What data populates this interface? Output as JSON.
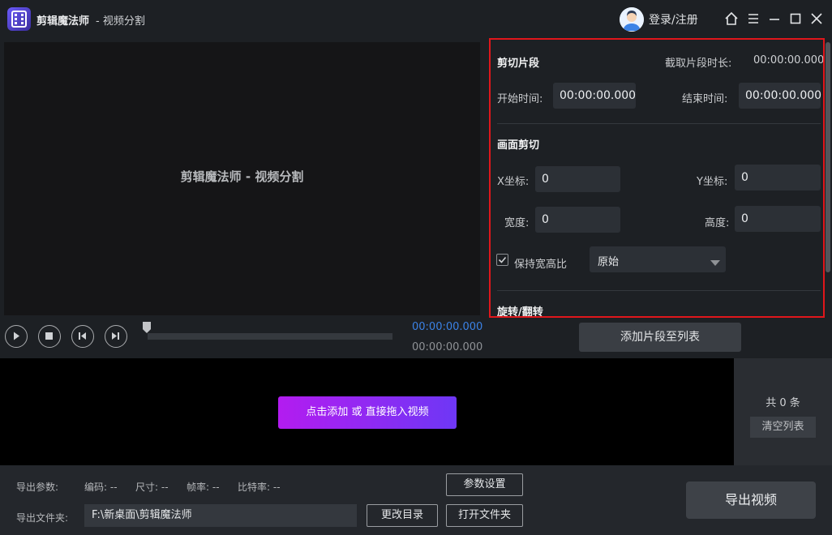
{
  "titlebar": {
    "app_name": "剪辑魔法师",
    "app_sub": "- 视频分割",
    "login": "登录/注册"
  },
  "preview": {
    "title": "剪辑魔法师 - 视频分割"
  },
  "player": {
    "current_time": "00:00:00.000",
    "total_time": "00:00:00.000",
    "progress": 0
  },
  "cut_segment": {
    "title": "剪切片段",
    "duration_label": "截取片段时长:",
    "duration_value": "00:00:00.000",
    "start_label": "开始时间:",
    "start_value": "00:00:00.000",
    "end_label": "结束时间:",
    "end_value": "00:00:00.000"
  },
  "crop": {
    "title": "画面剪切",
    "x_label": "X坐标:",
    "x_value": "0",
    "y_label": "Y坐标:",
    "y_value": "0",
    "width_label": "宽度:",
    "width_value": "0",
    "height_label": "高度:",
    "height_value": "0",
    "keep_ratio_label": "保持宽高比",
    "keep_ratio_checked": true,
    "ratio_selected": "原始"
  },
  "rotate": {
    "title": "旋转/翻转"
  },
  "add_segment_button": "添加片段至列表",
  "list": {
    "add_video_button": "点击添加 或 直接拖入视频",
    "count_text": "共 0 条",
    "clear_button": "清空列表"
  },
  "export": {
    "params_label": "导出参数:",
    "codec": "编码: --",
    "size": "尺寸: --",
    "fps": "帧率: --",
    "bitrate": "比特率: --",
    "settings_button": "参数设置",
    "folder_label": "导出文件夹:",
    "folder_path": "F:\\新桌面\\剪辑魔法师",
    "change_dir_button": "更改目录",
    "open_folder_button": "打开文件夹",
    "export_button": "导出视频"
  },
  "colors": {
    "accent_blue": "#3b82e6",
    "highlight_red": "#e0161b",
    "gradient_start": "#b31cf0",
    "gradient_end": "#6e37f5"
  }
}
